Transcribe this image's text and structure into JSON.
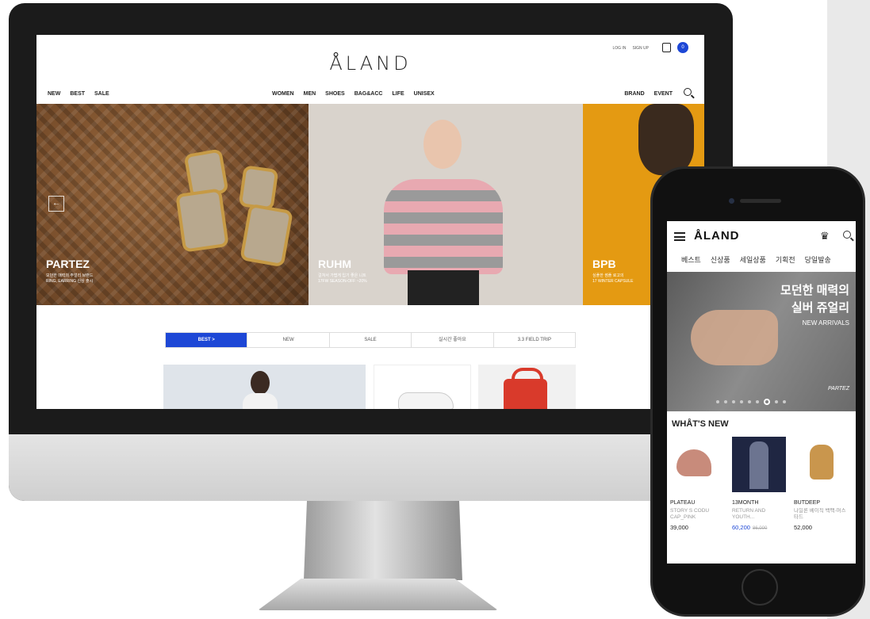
{
  "desktop": {
    "logo": "ÅLAND",
    "util": {
      "login": "LOG IN",
      "signup": "SIGN UP",
      "cart_count": "0"
    },
    "nav_left": [
      "NEW",
      "BEST",
      "SALE"
    ],
    "nav_center": [
      "WOMEN",
      "MEN",
      "SHOES",
      "BAG&ACC",
      "LIFE",
      "UNISEX"
    ],
    "nav_right": [
      "BRAND",
      "EVENT"
    ],
    "hero": [
      {
        "title": "PARTEZ",
        "sub1": "모던한 매력의 주얼리 브랜드",
        "sub2": "RING, EARRING 신상 출시"
      },
      {
        "title": "RUHM",
        "sub1": "걸쳐서 가볍게 입기 좋은 니트",
        "sub2": "17FW SEASON-OFF ~20%"
      },
      {
        "title": "BPB",
        "sub1": "심플한 썸플 로고의",
        "sub2": "17 WINTER CAPSULE"
      }
    ],
    "prev_arrow": "←",
    "tabs": [
      "BEST >",
      "NEW",
      "SALE",
      "실시간 좋아요",
      "3.3 FIELD TRIP"
    ]
  },
  "mobile": {
    "logo": "ÅLAND",
    "nav": [
      "베스트",
      "신상품",
      "세일상품",
      "기획전",
      "당일발송"
    ],
    "banner": {
      "line1": "모던한 매력의",
      "line2": "실버 쥬얼리",
      "sub": "NEW ARRIVALS",
      "brand": "PARTEZ"
    },
    "section_title": "WHÅT'S NEW",
    "items": [
      {
        "brand": "PLATEAU",
        "name": "STORY S CODU CAP_PINK",
        "price": "39,000",
        "old_price": ""
      },
      {
        "brand": "13MONTH",
        "name": "RETURN AND YOUTH...",
        "price": "60,200",
        "old_price": "86,000"
      },
      {
        "brand": "BUTDEEP",
        "name": "나일론 베이직 백팩-머스타드",
        "price": "52,000",
        "old_price": ""
      }
    ],
    "carousel": {
      "count": 9,
      "active": 7
    }
  }
}
